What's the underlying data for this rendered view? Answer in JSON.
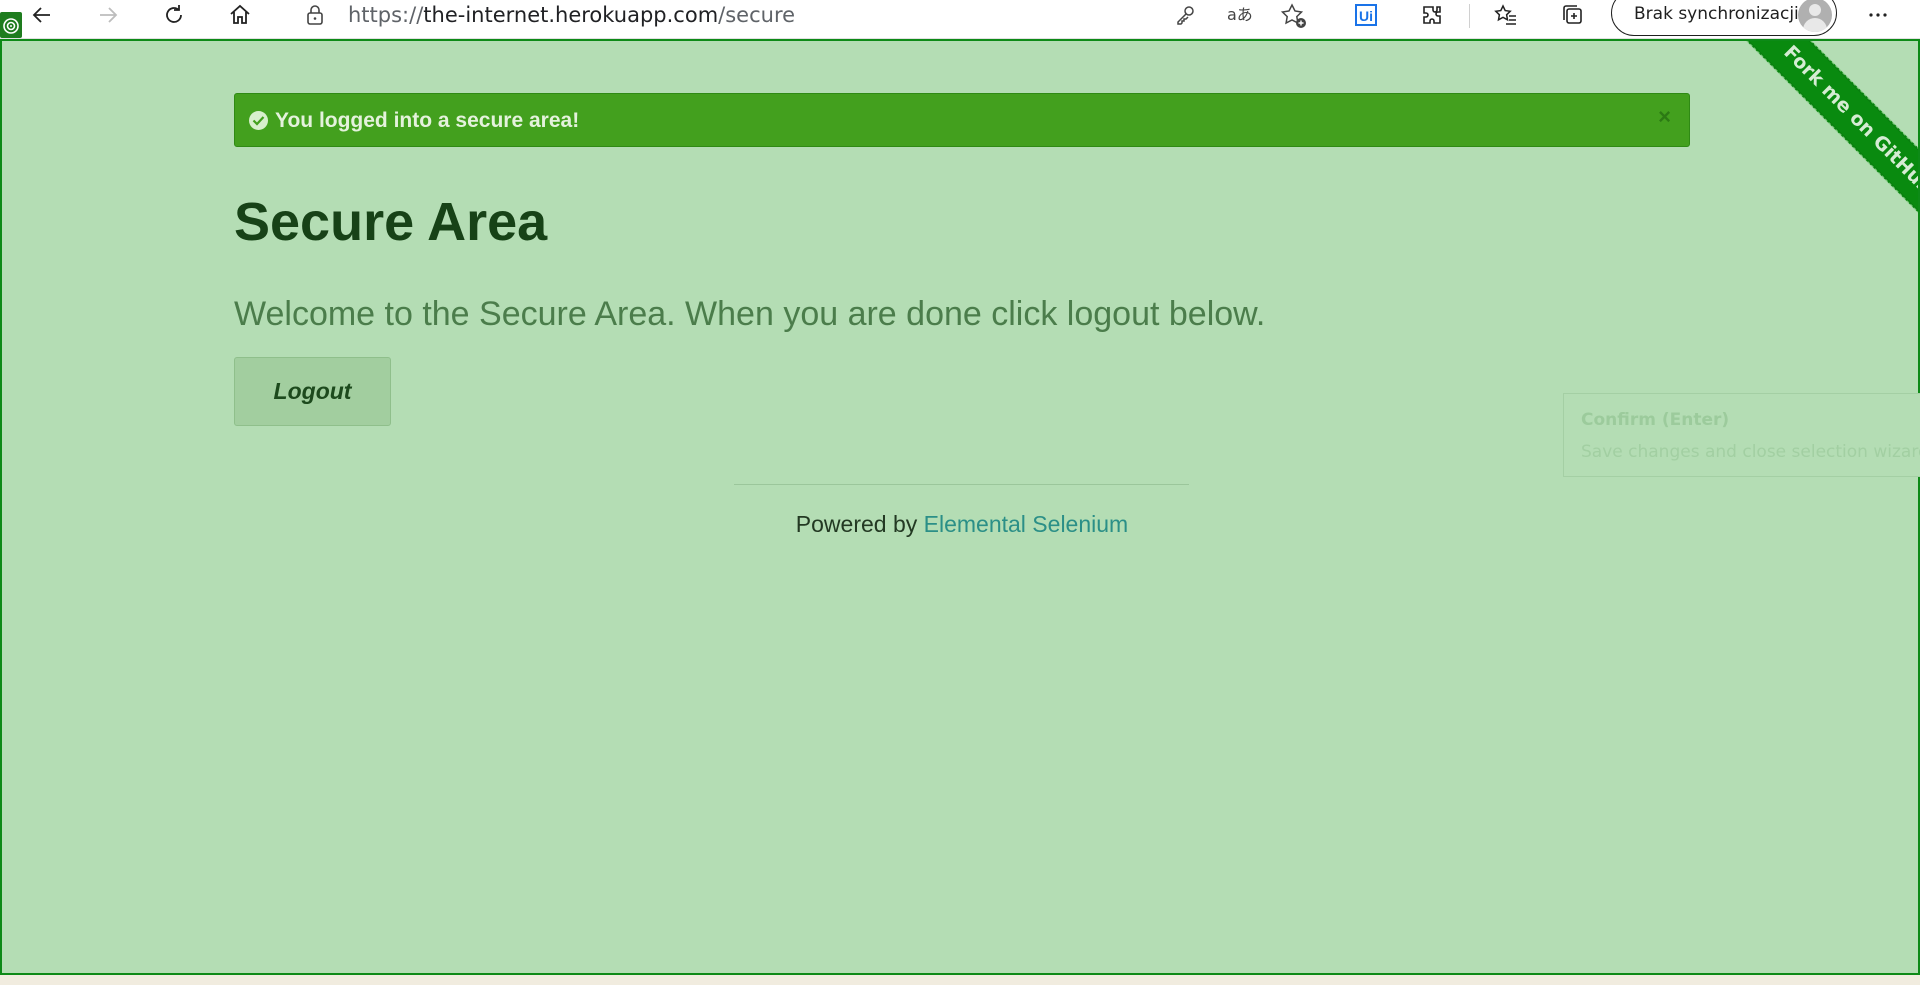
{
  "browser": {
    "url_scheme": "https://",
    "url_host": "the-internet.herokuapp.com",
    "url_path": "/secure",
    "profile_label": "Brak synchronizacji",
    "icons": [
      "back-icon",
      "forward-icon",
      "refresh-icon",
      "home-icon",
      "lock-icon",
      "key-icon",
      "read-aloud-icon",
      "add-favorite-icon",
      "uipath-extension-icon",
      "extensions-icon",
      "favorites-icon",
      "collections-icon",
      "profile-avatar-icon",
      "more-icon"
    ]
  },
  "flash": {
    "message": "You logged into a secure area!",
    "close": "×",
    "color": "#43a01e"
  },
  "main": {
    "heading": "Secure Area",
    "subheading": "Welcome to the Secure Area. When you are done click logout below.",
    "logout_label": "Logout"
  },
  "footer": {
    "powered_by": "Powered by ",
    "link_text": "Elemental Selenium"
  },
  "ribbon": {
    "label": "Fork me on GitHub"
  },
  "tooltip": {
    "title": "Confirm (Enter)",
    "description": "Save changes and close selection wizard."
  },
  "colors": {
    "page_overlay": "#b4ddb4",
    "page_border": "#0d8a17",
    "link": "#2b8f87"
  }
}
